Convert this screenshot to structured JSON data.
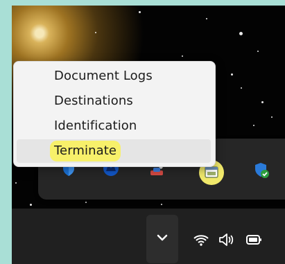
{
  "context_menu": {
    "items": [
      {
        "label": "Document Logs"
      },
      {
        "label": "Destinations"
      },
      {
        "label": "Identification"
      },
      {
        "label": "Terminate"
      }
    ]
  },
  "colors": {
    "menu_bg": "#f3f3f3",
    "menu_hover": "#e5e5e5",
    "highlight": "#f7f06a",
    "taskbar": "#202020",
    "tray_panel": "#262626"
  },
  "tray_icons": [
    {
      "icon": "shield-icon"
    },
    {
      "icon": "antivirus-icon"
    },
    {
      "icon": "paint-brush-icon"
    },
    {
      "icon": "app-window-icon"
    },
    {
      "icon": "security-check-shield-icon"
    }
  ],
  "system_tray": {
    "chevron": "chevron-down-icon",
    "wifi": "wifi-icon",
    "volume": "volume-icon",
    "battery": "battery-icon"
  }
}
